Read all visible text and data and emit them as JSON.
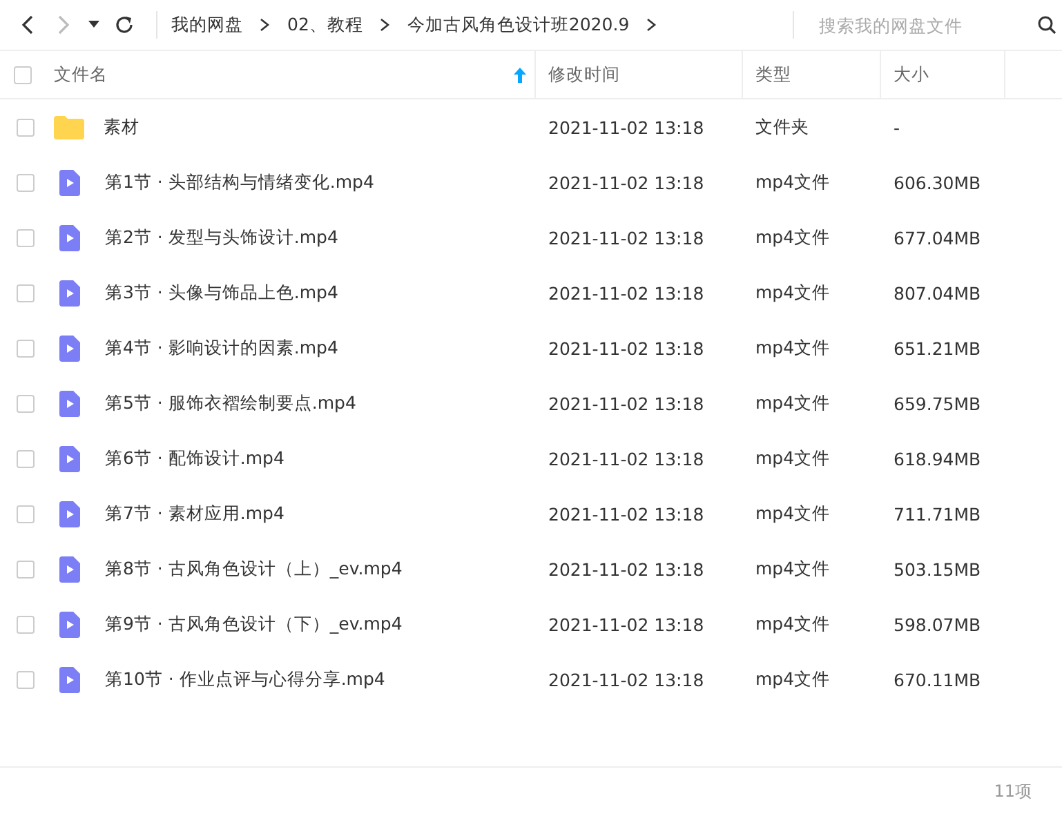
{
  "breadcrumb": [
    "我的网盘",
    "02、教程",
    "今加古风角色设计班2020.9"
  ],
  "search": {
    "placeholder": "搜索我的网盘文件"
  },
  "columns": [
    {
      "label": "文件名",
      "sorted": true
    },
    {
      "label": "修改时间",
      "sorted": false
    },
    {
      "label": "类型",
      "sorted": false
    },
    {
      "label": "大小",
      "sorted": false
    }
  ],
  "select_all": {
    "checked": false
  },
  "rows": [
    {
      "kind": "folder",
      "name": "素材",
      "modified": "2021-11-02 13:18",
      "type": "文件夹",
      "size": "-",
      "checked": false
    },
    {
      "kind": "video",
      "name": "第1节 · 头部结构与情绪变化.mp4",
      "modified": "2021-11-02 13:18",
      "type": "mp4文件",
      "size": "606.30MB",
      "checked": false
    },
    {
      "kind": "video",
      "name": "第2节 · 发型与头饰设计.mp4",
      "modified": "2021-11-02 13:18",
      "type": "mp4文件",
      "size": "677.04MB",
      "checked": false
    },
    {
      "kind": "video",
      "name": "第3节 · 头像与饰品上色.mp4",
      "modified": "2021-11-02 13:18",
      "type": "mp4文件",
      "size": "807.04MB",
      "checked": false
    },
    {
      "kind": "video",
      "name": "第4节 · 影响设计的因素.mp4",
      "modified": "2021-11-02 13:18",
      "type": "mp4文件",
      "size": "651.21MB",
      "checked": false
    },
    {
      "kind": "video",
      "name": "第5节 · 服饰衣褶绘制要点.mp4",
      "modified": "2021-11-02 13:18",
      "type": "mp4文件",
      "size": "659.75MB",
      "checked": false
    },
    {
      "kind": "video",
      "name": "第6节 · 配饰设计.mp4",
      "modified": "2021-11-02 13:18",
      "type": "mp4文件",
      "size": "618.94MB",
      "checked": false
    },
    {
      "kind": "video",
      "name": "第7节 · 素材应用.mp4",
      "modified": "2021-11-02 13:18",
      "type": "mp4文件",
      "size": "711.71MB",
      "checked": false
    },
    {
      "kind": "video",
      "name": "第8节 · 古风角色设计（上）_ev.mp4",
      "modified": "2021-11-02 13:18",
      "type": "mp4文件",
      "size": "503.15MB",
      "checked": false
    },
    {
      "kind": "video",
      "name": "第9节 · 古风角色设计（下）_ev.mp4",
      "modified": "2021-11-02 13:18",
      "type": "mp4文件",
      "size": "598.07MB",
      "checked": false
    },
    {
      "kind": "video",
      "name": "第10节 · 作业点评与心得分享.mp4",
      "modified": "2021-11-02 13:18",
      "type": "mp4文件",
      "size": "670.11MB",
      "checked": false
    }
  ],
  "status_bar": {
    "count": "11项"
  }
}
